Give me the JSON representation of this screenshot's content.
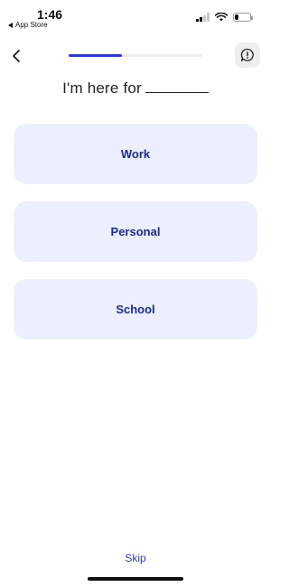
{
  "status_bar": {
    "time": "1:46",
    "back_app_label": "App Store",
    "signal_bars_active": 2,
    "signal_bars_total": 4,
    "battery_level": 0.35
  },
  "nav": {
    "back_icon": "chevron-left-icon",
    "help_icon": "message-alert-icon",
    "progress": 0.4,
    "progress_color": "#2b3ad6"
  },
  "prompt": {
    "text": "I'm here for"
  },
  "options": [
    {
      "label": "Work"
    },
    {
      "label": "Personal"
    },
    {
      "label": "School"
    }
  ],
  "footer": {
    "skip_label": "Skip"
  },
  "colors": {
    "accent": "#2b3ad6",
    "option_bg": "#eceffd",
    "option_text": "#1c2a9e"
  }
}
